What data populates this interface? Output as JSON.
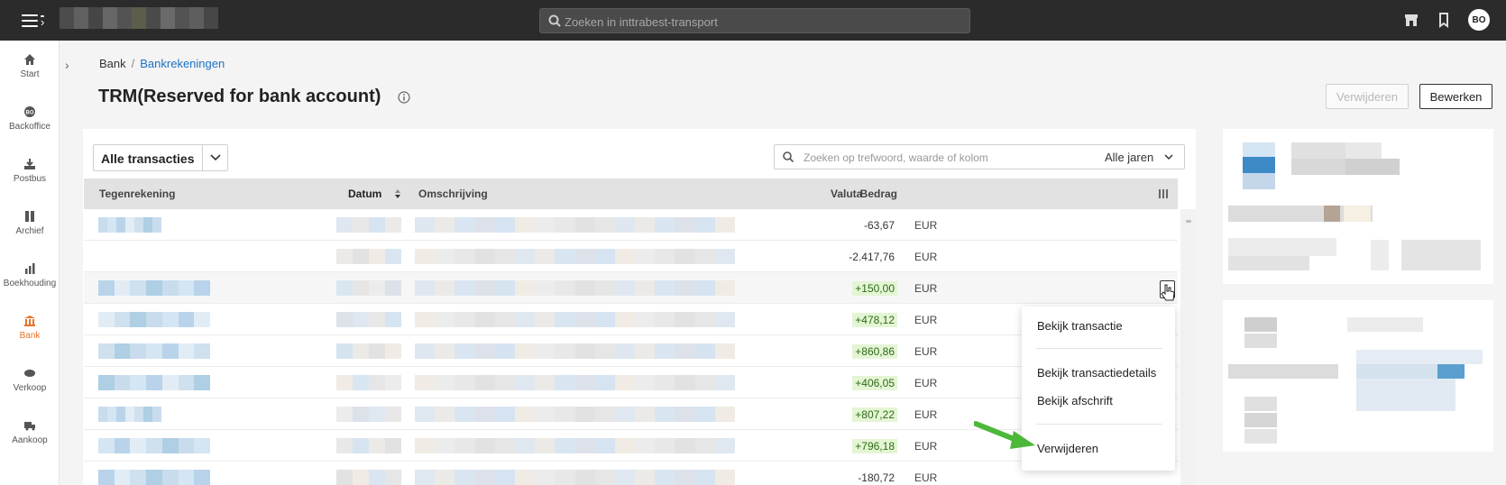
{
  "topbar": {
    "search_placeholder": "Zoeken in inttrabest-transport",
    "avatar_initials": "BO"
  },
  "sidebar": {
    "items": [
      {
        "label": "Start",
        "icon": "home-icon"
      },
      {
        "label": "Backoffice",
        "icon": "backoffice-icon"
      },
      {
        "label": "Postbus",
        "icon": "inbox-icon"
      },
      {
        "label": "Archief",
        "icon": "archive-icon"
      },
      {
        "label": "Boekhouding",
        "icon": "bar-chart-icon"
      },
      {
        "label": "Bank",
        "icon": "bank-icon",
        "active": true
      },
      {
        "label": "Verkoop",
        "icon": "handshake-icon"
      },
      {
        "label": "Aankoop",
        "icon": "truck-icon"
      }
    ],
    "active_color": "#e8742a"
  },
  "breadcrumb": {
    "root": "Bank",
    "separator": "/",
    "current": "Bankrekeningen"
  },
  "page": {
    "title": "TRM(Reserved for bank account)"
  },
  "actions": {
    "delete_label": "Verwijderen",
    "edit_label": "Bewerken"
  },
  "filters": {
    "transaction_filter": "Alle transacties",
    "search_placeholder": "Zoeken op trefwoord, waarde of kolom",
    "year_filter": "Alle jaren"
  },
  "table": {
    "columns": [
      "Tegenrekening",
      "Datum",
      "Omschrijving",
      "Bedrag",
      "Valuta"
    ],
    "rows": [
      {
        "amount": "-63,67",
        "currency": "EUR",
        "positive": false
      },
      {
        "amount": "-2.417,76",
        "currency": "EUR",
        "positive": false
      },
      {
        "amount": "+150,00",
        "currency": "EUR",
        "positive": true
      },
      {
        "amount": "+478,12",
        "currency": "EUR",
        "positive": true
      },
      {
        "amount": "+860,86",
        "currency": "EUR",
        "positive": true
      },
      {
        "amount": "+406,05",
        "currency": "EUR",
        "positive": true
      },
      {
        "amount": "+807,22",
        "currency": "EUR",
        "positive": true
      },
      {
        "amount": "+796,18",
        "currency": "EUR",
        "positive": true
      },
      {
        "amount": "-180,72",
        "currency": "EUR",
        "positive": false
      }
    ]
  },
  "context_menu": {
    "items": [
      "Bekijk transactie",
      "Bekijk transactiedetails",
      "Bekijk afschrift",
      "Verwijderen"
    ]
  },
  "colors": {
    "topbar_bg": "#2b2b2b",
    "link_blue": "#1a72c4",
    "positive_bg": "#e4f5d4",
    "arrow_green": "#4cb83a"
  }
}
